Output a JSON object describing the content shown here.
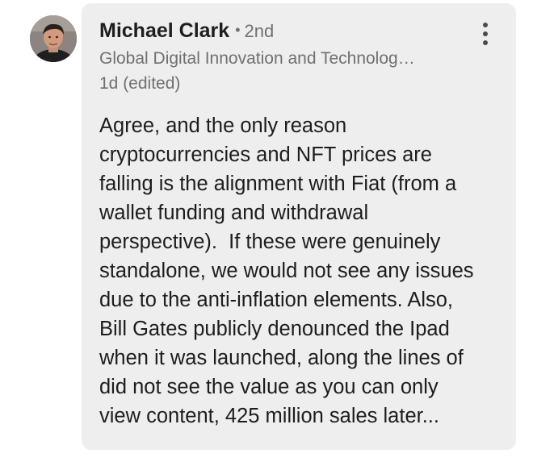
{
  "comment": {
    "author": {
      "name": "Michael Clark",
      "separator": "•",
      "degree": "2nd",
      "headline": "Global Digital Innovation and Technolog…",
      "avatar_icon": "profile-photo"
    },
    "timestamp": "1d (edited)",
    "more_icon": "vertical-ellipsis-icon",
    "body_lines": [
      "Agree, and the only reason",
      "cryptocurrencies and NFT prices are",
      "falling is the alignment with Fiat (from a",
      "wallet funding and withdrawal",
      "perspective).  If these were genuinely",
      "standalone, we would not see any issues",
      "due to the anti-inflation elements. Also,",
      "Bill Gates publicly denounced the Ipad",
      "when it was launched, along the lines of",
      "did not see the value as you can only",
      "view content, 425 million sales later..."
    ],
    "colors": {
      "bubble_background": "#eeeeee",
      "secondary_text": "#707070",
      "primary_text": "#1d1d1d"
    }
  }
}
